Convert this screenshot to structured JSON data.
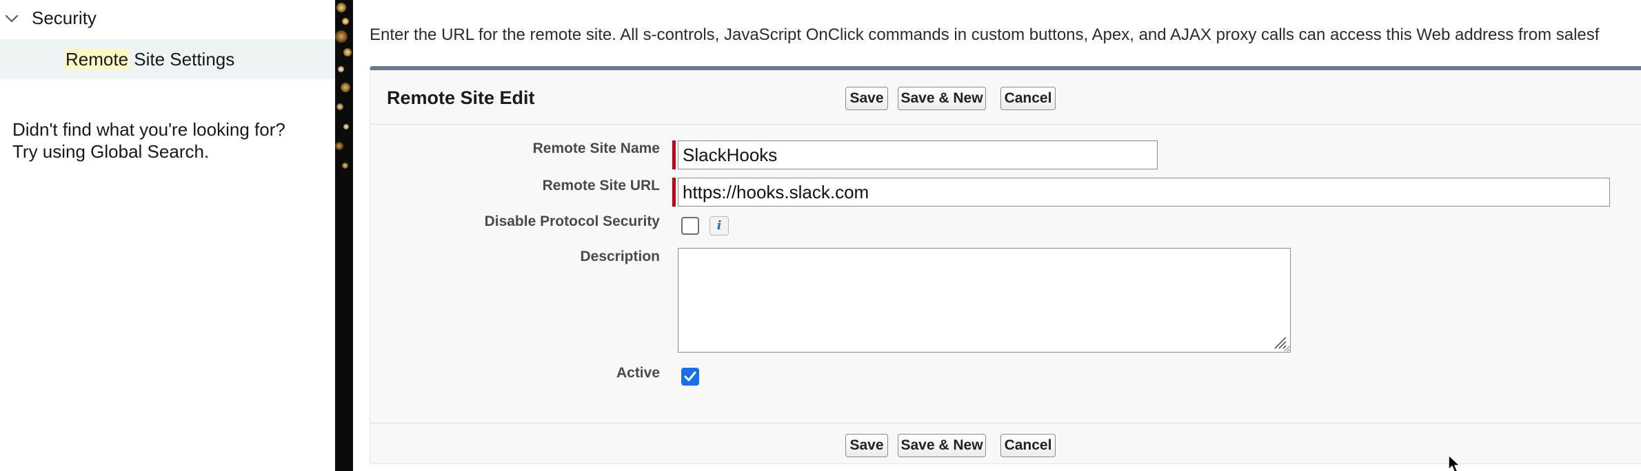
{
  "sidebar": {
    "section_label": "Security",
    "item": {
      "label_highlight": "Remote",
      "label_rest": " Site Settings"
    },
    "help_line1": "Didn't find what you're looking for?",
    "help_line2": "Try using Global Search."
  },
  "main": {
    "intro_text": "Enter the URL for the remote site. All s-controls, JavaScript OnClick commands in custom buttons, Apex, and AJAX proxy calls can access this Web address from salesf"
  },
  "panel": {
    "title": "Remote Site Edit",
    "buttons": {
      "save": "Save",
      "save_new": "Save & New",
      "cancel": "Cancel"
    }
  },
  "form": {
    "remote_site_name": {
      "label": "Remote Site Name",
      "value": "SlackHooks",
      "required": true
    },
    "remote_site_url": {
      "label": "Remote Site URL",
      "value": "https://hooks.slack.com",
      "required": true
    },
    "disable_protocol_security": {
      "label": "Disable Protocol Security",
      "checked": false,
      "info_glyph": "i"
    },
    "description": {
      "label": "Description",
      "value": ""
    },
    "active": {
      "label": "Active",
      "checked": true
    }
  },
  "colors": {
    "required_marker": "#c20014",
    "checkbox_checked": "#1b6fe6",
    "panel_top_border": "#687a8c",
    "sidebar_selected_bg": "#eef4f6",
    "search_highlight": "#fcf8c4"
  }
}
